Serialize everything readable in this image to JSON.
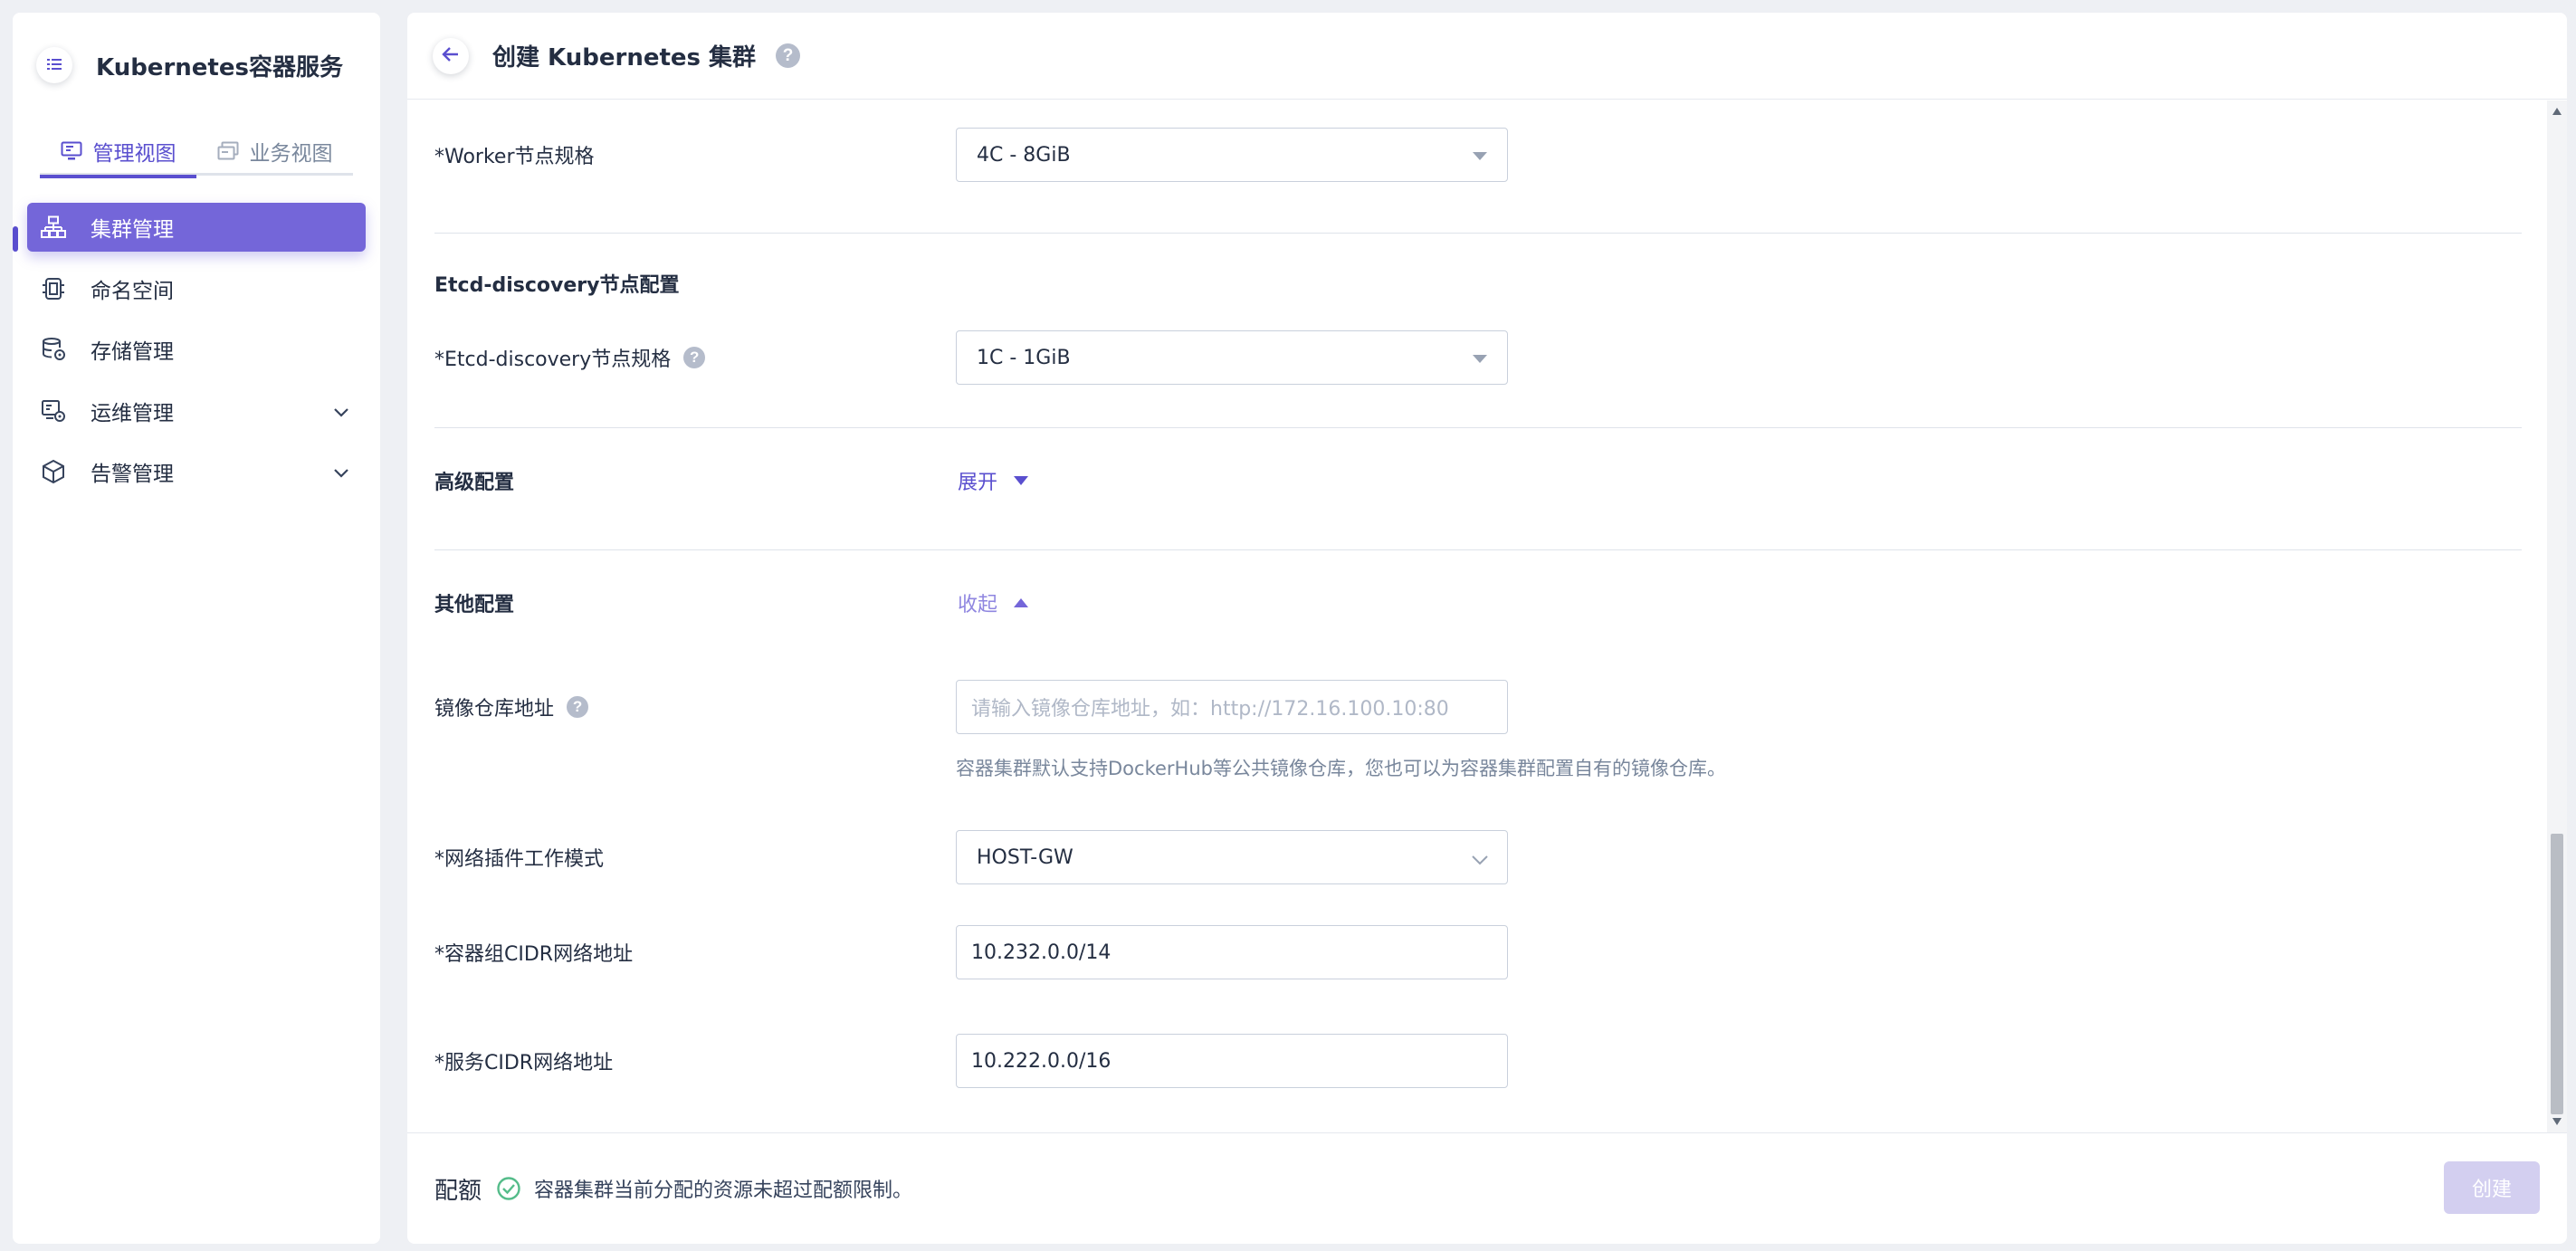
{
  "sidebar": {
    "title": "Kubernetes容器服务",
    "view_tabs": [
      {
        "label": "管理视图",
        "active": true
      },
      {
        "label": "业务视图",
        "active": false
      }
    ],
    "nav": [
      {
        "label": "集群管理",
        "icon": "cluster-icon",
        "active": true
      },
      {
        "label": "命名空间",
        "icon": "namespace-icon",
        "active": false
      },
      {
        "label": "存储管理",
        "icon": "storage-icon",
        "active": false
      },
      {
        "label": "运维管理",
        "icon": "ops-icon",
        "active": false,
        "expandable": true
      },
      {
        "label": "告警管理",
        "icon": "alert-icon",
        "active": false,
        "expandable": true
      }
    ]
  },
  "header": {
    "title": "创建 Kubernetes 集群",
    "help": "?"
  },
  "form": {
    "worker_spec": {
      "label": "*Worker节点规格",
      "value": "4C - 8GiB"
    },
    "etcd_section_title": "Etcd-discovery节点配置",
    "etcd_spec": {
      "label": "*Etcd-discovery节点规格",
      "value": "1C - 1GiB"
    },
    "advanced": {
      "title": "高级配置",
      "toggle": "展开"
    },
    "other": {
      "title": "其他配置",
      "toggle": "收起"
    },
    "registry": {
      "label": "镜像仓库地址",
      "placeholder": "请输入镜像仓库地址，如：http://172.16.100.10:80",
      "hint": "容器集群默认支持DockerHub等公共镜像仓库，您也可以为容器集群配置自有的镜像仓库。"
    },
    "network_mode": {
      "label": "*网络插件工作模式",
      "value": "HOST-GW"
    },
    "pod_cidr": {
      "label": "*容器组CIDR网络地址",
      "value": "10.232.0.0/14"
    },
    "service_cidr": {
      "label": "*服务CIDR网络地址",
      "value": "10.222.0.0/16"
    }
  },
  "footer": {
    "quota_title": "配额",
    "quota_text": "容器集群当前分配的资源未超过配额限制。",
    "create_label": "创建"
  },
  "colors": {
    "accent": "#5a4fcf",
    "active_nav": "#7466d9",
    "success": "#55bc8a",
    "disabled_button": "#d3cff0"
  }
}
